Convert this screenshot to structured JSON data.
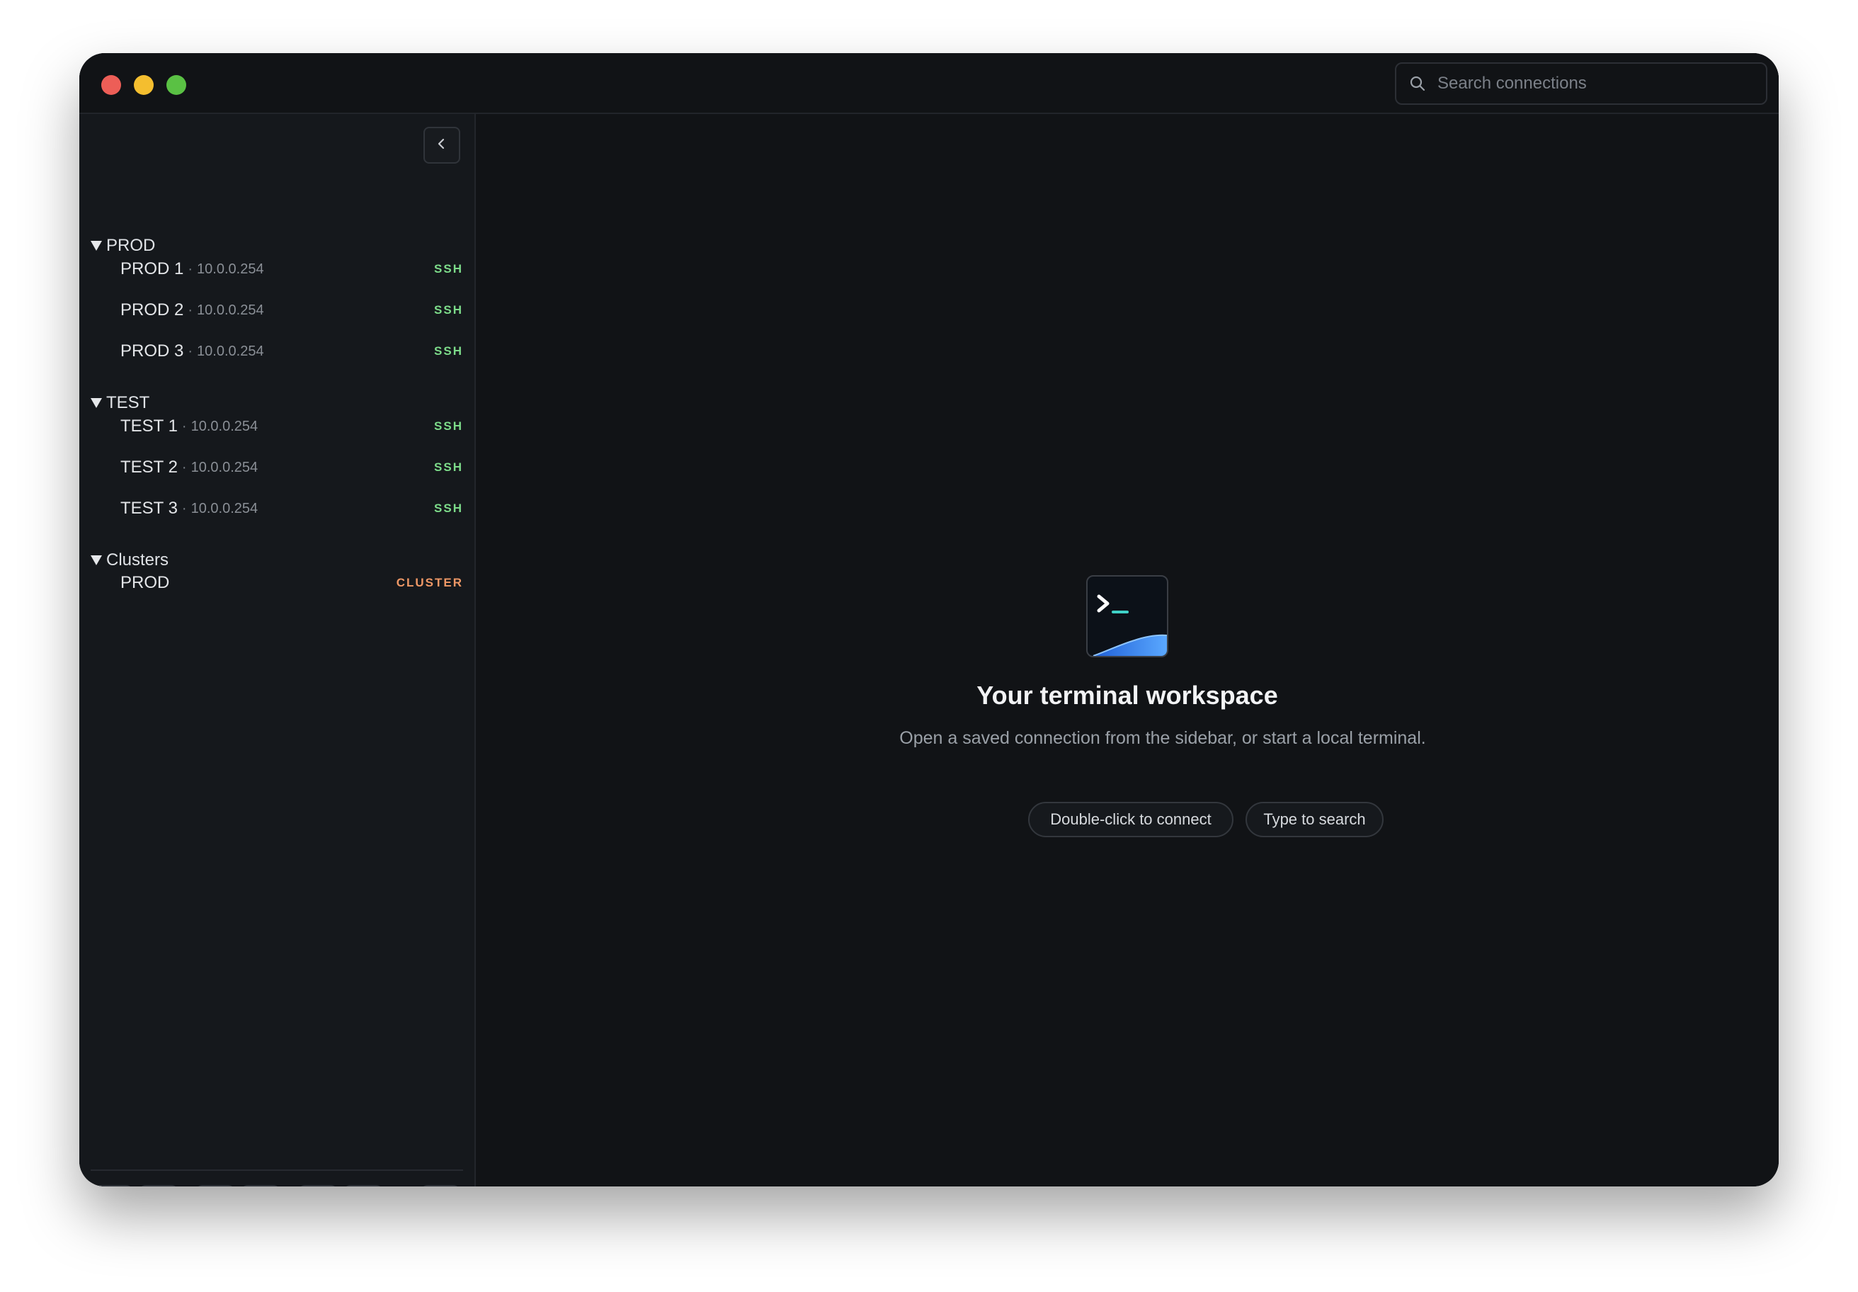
{
  "titlebar": {
    "search_placeholder": "Search connections"
  },
  "sidebar": {
    "groups": [
      {
        "label": "PROD",
        "items": [
          {
            "name": "PROD 1",
            "ip": "10.0.0.254",
            "badge": "SSH"
          },
          {
            "name": "PROD 2",
            "ip": "10.0.0.254",
            "badge": "SSH"
          },
          {
            "name": "PROD 3",
            "ip": "10.0.0.254",
            "badge": "SSH"
          }
        ]
      },
      {
        "label": "TEST",
        "items": [
          {
            "name": "TEST 1",
            "ip": "10.0.0.254",
            "badge": "SSH"
          },
          {
            "name": "TEST 2",
            "ip": "10.0.0.254",
            "badge": "SSH"
          },
          {
            "name": "TEST 3",
            "ip": "10.0.0.254",
            "badge": "SSH"
          }
        ]
      },
      {
        "label": "Clusters",
        "items": [
          {
            "name": "PROD",
            "badge": "CLUSTER"
          }
        ]
      }
    ],
    "separator": "·",
    "toolbar_icons": [
      "sync-icon",
      "gear-icon",
      "plus-icon",
      "sparkle-plus-icon",
      "link-icon",
      "bookmark-icon",
      "terminal-icon"
    ]
  },
  "main": {
    "empty_title": "Your terminal workspace",
    "empty_desc": "Open a saved connection from the sidebar, or start a local terminal.",
    "hints": [
      "Double-click to connect",
      "Type to search"
    ]
  },
  "colors": {
    "ssh": "#7ddc8a",
    "cluster": "#ef9866",
    "status_online": "#4cc468"
  }
}
